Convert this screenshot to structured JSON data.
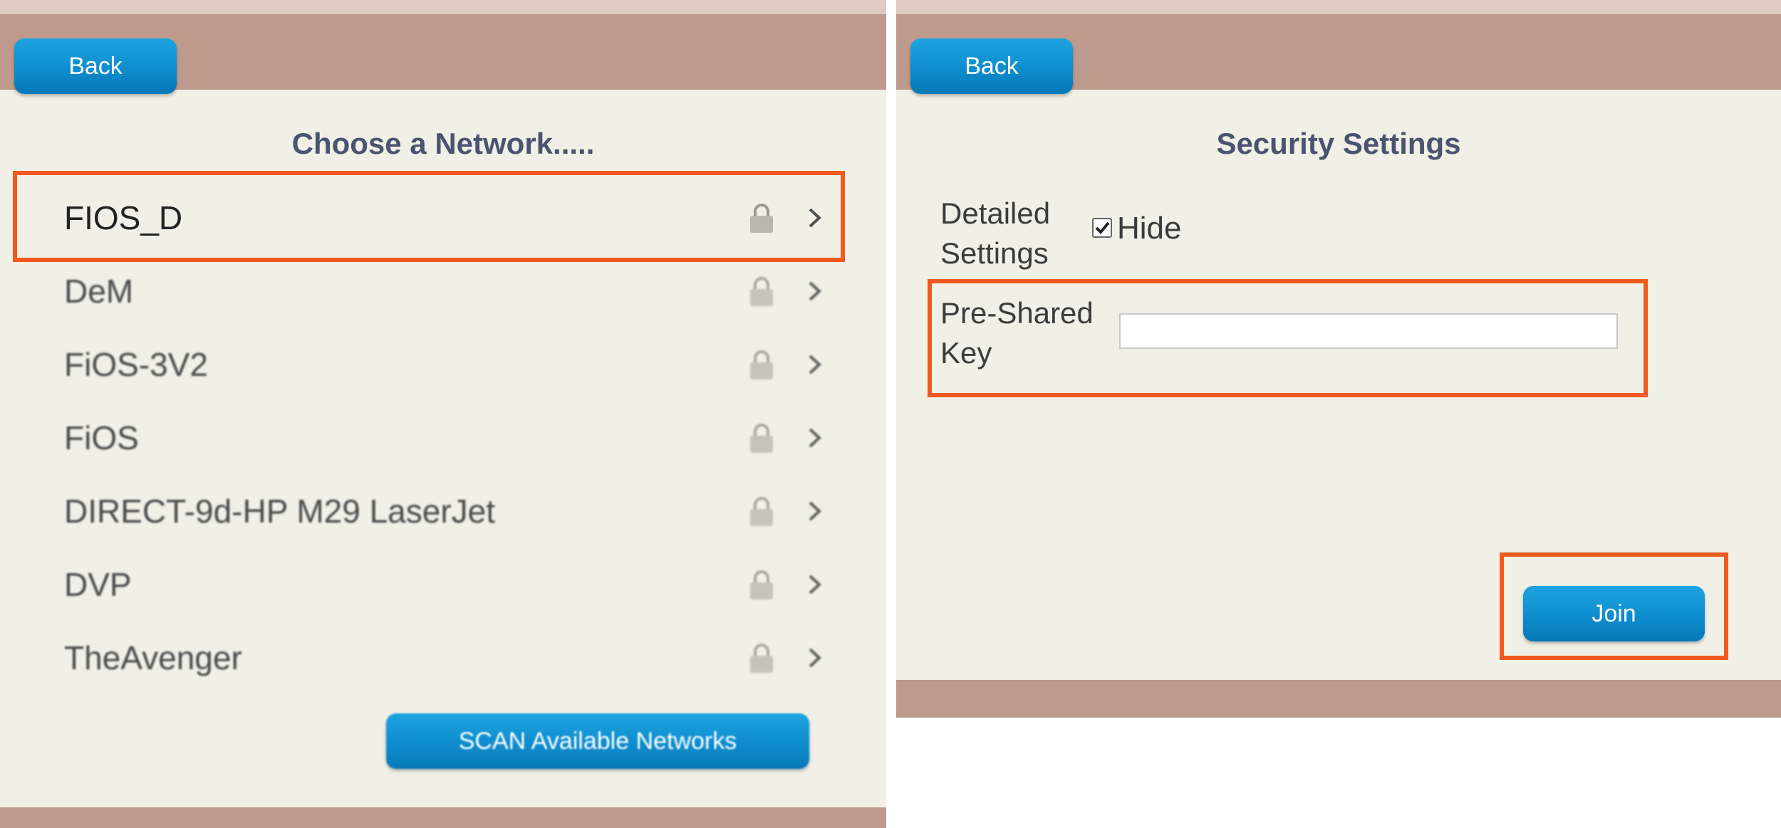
{
  "left_panel": {
    "back_label": "Back",
    "title": "Choose a Network.....",
    "networks": [
      {
        "name": "FIOS_D",
        "icon": "lock-icon",
        "selected": true
      },
      {
        "name": "DeM",
        "icon": "lock-icon"
      },
      {
        "name": "FiOS-3V2",
        "icon": "lock-icon"
      },
      {
        "name": "FiOS",
        "icon": "lock-icon"
      },
      {
        "name": "DIRECT-9d-HP M29 LaserJet",
        "icon": "lock-icon"
      },
      {
        "name": "DVP",
        "icon": "lock-icon"
      },
      {
        "name": "TheAvenger",
        "icon": "lock-icon"
      }
    ],
    "scan_label": "SCAN Available Networks"
  },
  "right_panel": {
    "back_label": "Back",
    "title": "Security Settings",
    "detailed_settings_label": "Detailed Settings",
    "hide_checkbox": {
      "label": "Hide",
      "checked": true
    },
    "psk_label": "Pre-Shared Key",
    "psk_value": "",
    "join_label": "Join"
  },
  "colors": {
    "highlight": "#f05a1e",
    "button_blue": "#0f8fd0",
    "header_bar": "#bd9a8c",
    "panel_bg": "#f0f0e6",
    "title_text": "#4a5470"
  }
}
